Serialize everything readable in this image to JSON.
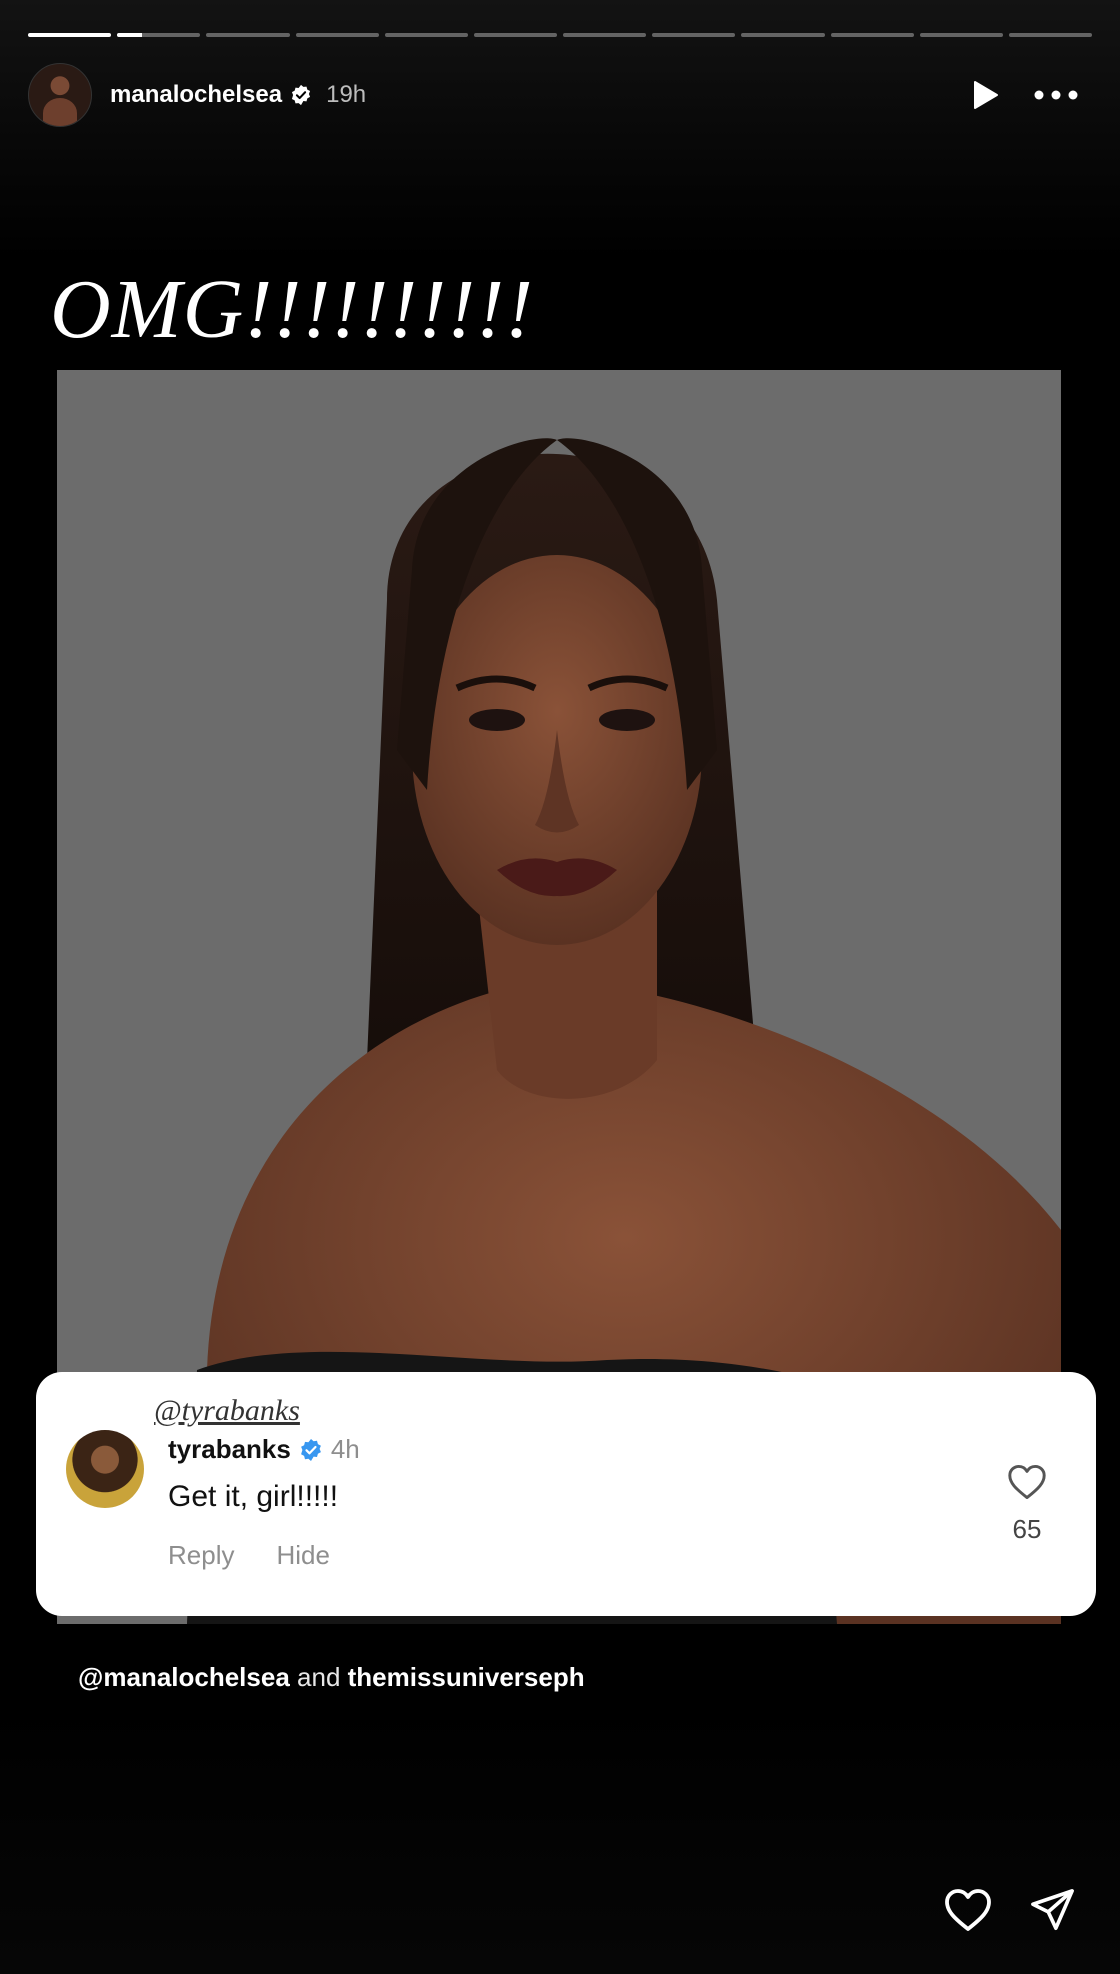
{
  "story": {
    "progress_segments": 12,
    "active_segment": 1,
    "active_progress": 0.3
  },
  "header": {
    "username": "manalochelsea",
    "time": "19h",
    "play_icon": "play-icon",
    "more_icon": "more-icon"
  },
  "story_text": "OMG!!!!!!!!!!",
  "comment": {
    "mention": "@tyrabanks",
    "username": "tyrabanks",
    "time": "4h",
    "text": "Get it, girl!!!!!",
    "reply_label": "Reply",
    "hide_label": "Hide",
    "like_count": "65"
  },
  "tagline": {
    "user1": "@manalochelsea",
    "joiner": " and ",
    "user2": "themissuniverseph"
  },
  "colors": {
    "verified_blue": "#3897f0",
    "photo_bg": "#6c6c6c"
  }
}
